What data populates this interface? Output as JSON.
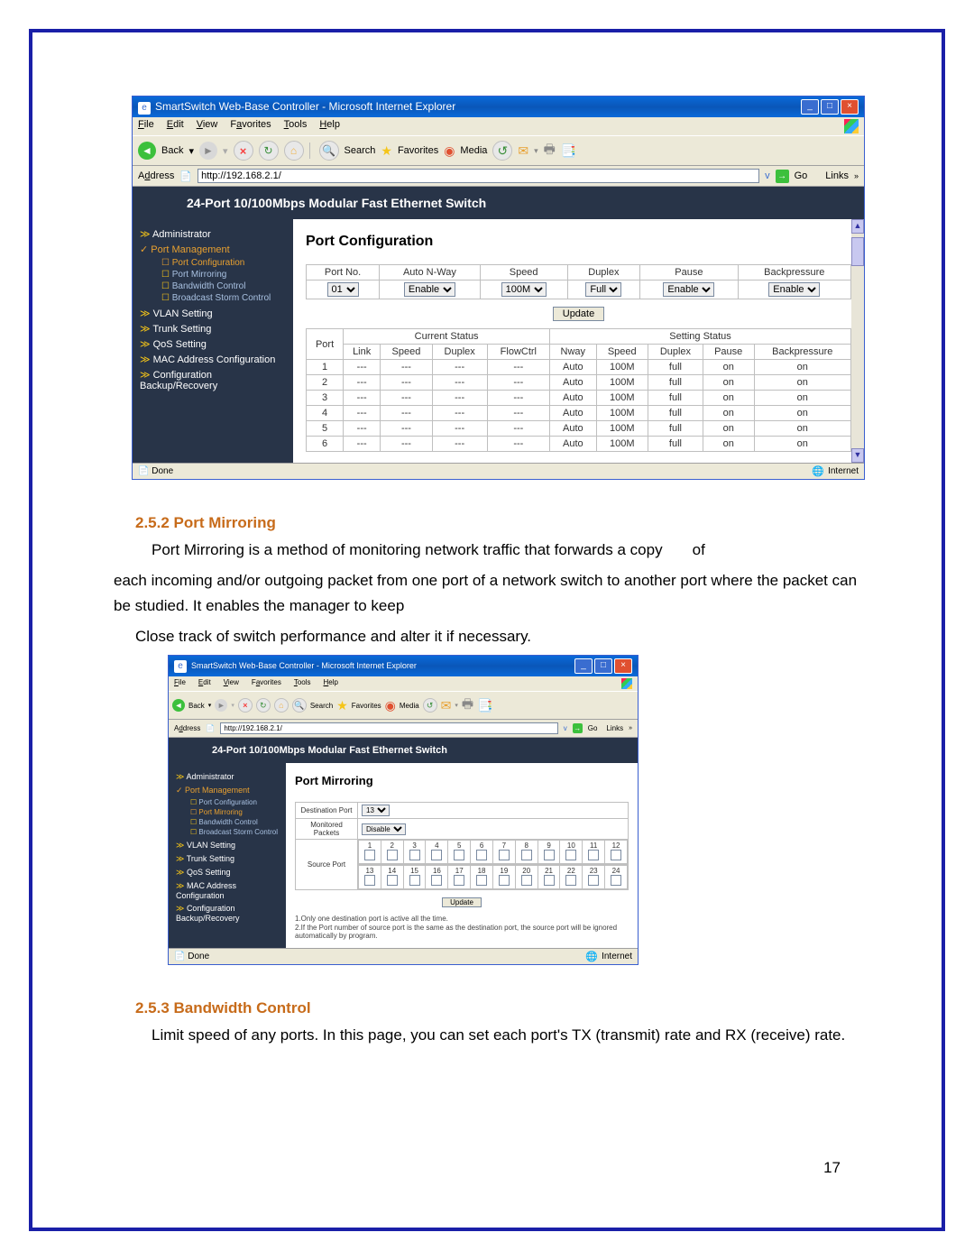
{
  "page_number": "17",
  "ie": {
    "title": "SmartSwitch Web-Base Controller - Microsoft Internet Explorer",
    "menu": [
      "File",
      "Edit",
      "View",
      "Favorites",
      "Tools",
      "Help"
    ],
    "toolbar": {
      "back": "Back",
      "search": "Search",
      "favorites": "Favorites",
      "media": "Media"
    },
    "address_label": "Address",
    "url": "http://192.168.2.1/",
    "go": "Go",
    "links": "Links",
    "status_done": "Done",
    "status_zone": "Internet"
  },
  "switch": {
    "banner": "24-Port 10/100Mbps Modular Fast Ethernet Switch",
    "side": {
      "admin": "Administrator",
      "portmgmt": "Port Management",
      "sub": [
        "Port Configuration",
        "Port Mirroring",
        "Bandwidth Control",
        "Broadcast Storm Control"
      ],
      "vlan": "VLAN Setting",
      "trunk": "Trunk Setting",
      "qos": "QoS Setting",
      "mac": "MAC Address Configuration",
      "config": "Configuration Backup/Recovery"
    }
  },
  "portconfig": {
    "title": "Port Configuration",
    "hdr": [
      "Port No.",
      "Auto N-Way",
      "Speed",
      "Duplex",
      "Pause",
      "Backpressure"
    ],
    "vals": {
      "portno": "01",
      "anw": "Enable",
      "speed": "100M",
      "duplex": "Full",
      "pause": "Enable",
      "bp": "Enable"
    },
    "update": "Update",
    "sthdr": {
      "port": "Port",
      "cs": "Current Status",
      "ss": "Setting Status"
    },
    "cur": [
      "Link",
      "Speed",
      "Duplex",
      "FlowCtrl"
    ],
    "set": [
      "Nway",
      "Speed",
      "Duplex",
      "Pause",
      "Backpressure"
    ],
    "rows": [
      {
        "p": "1",
        "cs": [
          "---",
          "---",
          "---",
          "---"
        ],
        "ss": [
          "Auto",
          "100M",
          "full",
          "on",
          "on"
        ]
      },
      {
        "p": "2",
        "cs": [
          "---",
          "---",
          "---",
          "---"
        ],
        "ss": [
          "Auto",
          "100M",
          "full",
          "on",
          "on"
        ]
      },
      {
        "p": "3",
        "cs": [
          "---",
          "---",
          "---",
          "---"
        ],
        "ss": [
          "Auto",
          "100M",
          "full",
          "on",
          "on"
        ]
      },
      {
        "p": "4",
        "cs": [
          "---",
          "---",
          "---",
          "---"
        ],
        "ss": [
          "Auto",
          "100M",
          "full",
          "on",
          "on"
        ]
      },
      {
        "p": "5",
        "cs": [
          "---",
          "---",
          "---",
          "---"
        ],
        "ss": [
          "Auto",
          "100M",
          "full",
          "on",
          "on"
        ]
      },
      {
        "p": "6",
        "cs": [
          "---",
          "---",
          "---",
          "---"
        ],
        "ss": [
          "Auto",
          "100M",
          "full",
          "on",
          "on"
        ]
      }
    ]
  },
  "sec252": {
    "h": "2.5.2 Port Mirroring",
    "p1a": "Port Mirroring is a method of monitoring network traffic that forwards a copy",
    "p1b": "of",
    "p2": "each incoming and/or outgoing packet from one port of a network switch to   another port where the packet can be studied. It enables the manager to keep",
    "p3": "Close track of switch performance and alter it if necessary."
  },
  "mirror": {
    "title": "Port Mirroring",
    "dest_label": "Destination Port",
    "dest_val": "13",
    "mon_label": "Monitored Packets",
    "mon_val": "Disable",
    "src_label": "Source Port",
    "ports_top": [
      "1",
      "2",
      "3",
      "4",
      "5",
      "6",
      "7",
      "8",
      "9",
      "10",
      "11",
      "12"
    ],
    "ports_bot": [
      "13",
      "14",
      "15",
      "16",
      "17",
      "18",
      "19",
      "20",
      "21",
      "22",
      "23",
      "24"
    ],
    "update": "Update",
    "note": "1.Only one destination port is active all the time.\n2.If the Port number of source port is the same as the destination port, the source port will be ignored automatically by program."
  },
  "sec253": {
    "h": "2.5.3 Bandwidth Control",
    "p": "Limit speed of any ports. In this page, you can set each port's TX (transmit) rate and RX (receive) rate."
  }
}
